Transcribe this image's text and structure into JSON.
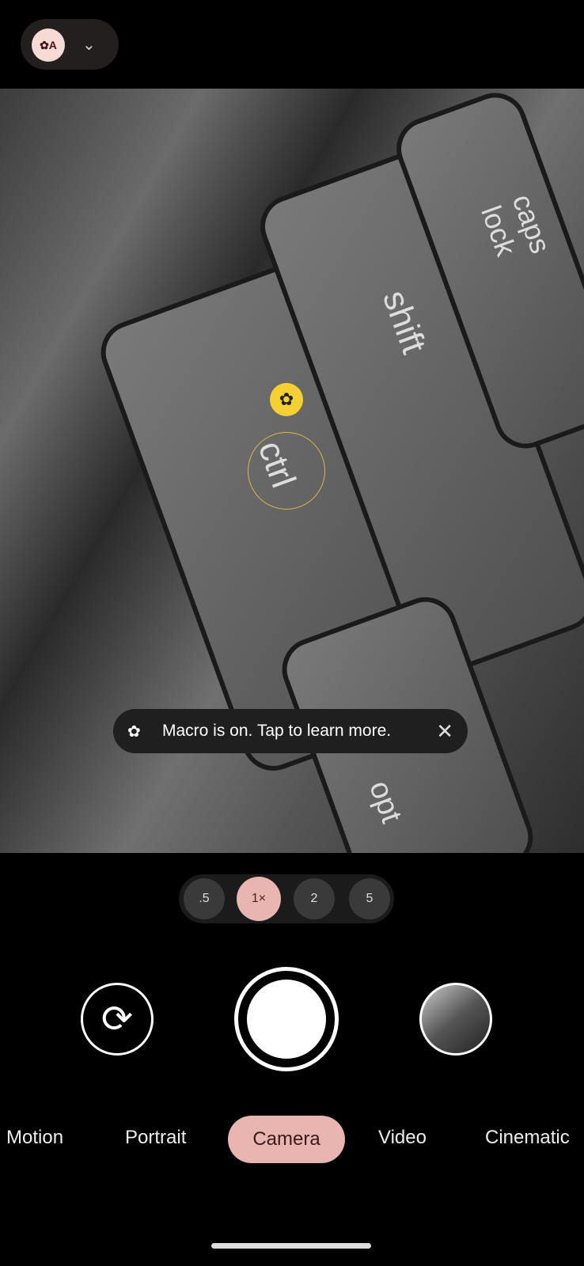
{
  "top": {
    "mode_icon": "macro-auto-icon",
    "dropdown_icon": "chevron-down-icon"
  },
  "viewfinder": {
    "macro_indicator": "flower-icon",
    "keys": [
      "ctrl",
      "shift",
      "caps lock",
      "opt"
    ]
  },
  "toast": {
    "icon": "macro-flower-icon",
    "text": "Macro is on. Tap to learn more.",
    "close": "✕"
  },
  "zoom": {
    "options": [
      ".5",
      "1×",
      "2",
      "5"
    ],
    "selected": "1×"
  },
  "controls": {
    "flip": "⟳",
    "flip_icon": "switch-camera-icon",
    "thumbnail": "last-photo-thumbnail"
  },
  "modes": [
    "Motion",
    "Portrait",
    "Camera",
    "Video",
    "Cinematic"
  ],
  "selected_mode": "Camera",
  "colors": {
    "accent": "#e8b5b0",
    "macro": "#f5d033"
  }
}
